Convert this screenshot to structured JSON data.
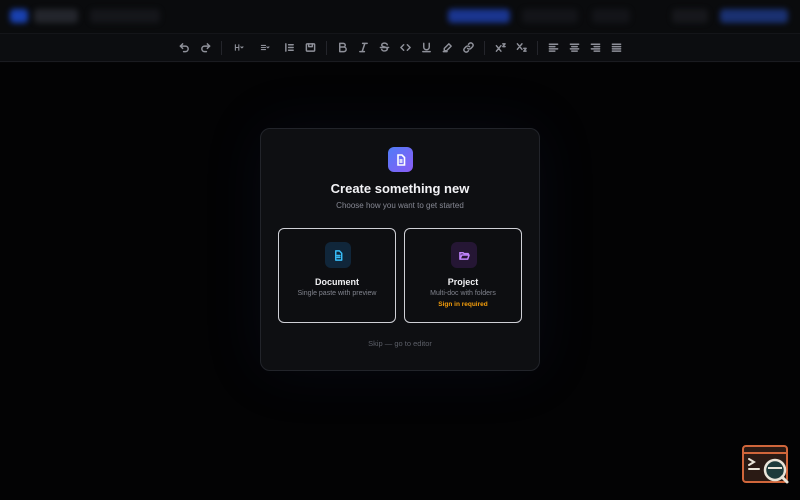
{
  "toolbar": {
    "buttons": [
      {
        "name": "undo-button",
        "icon": "undo-icon"
      },
      {
        "name": "redo-button",
        "icon": "redo-icon"
      },
      {
        "name": "heading-button",
        "icon": "heading-icon"
      },
      {
        "name": "list-button",
        "icon": "list-icon"
      },
      {
        "name": "ordered-list-button",
        "icon": "ordered-list-icon"
      },
      {
        "name": "block-button",
        "icon": "block-icon"
      },
      {
        "name": "bold-button",
        "icon": "bold-icon"
      },
      {
        "name": "italic-button",
        "icon": "italic-icon"
      },
      {
        "name": "strikethrough-button",
        "icon": "strikethrough-icon"
      },
      {
        "name": "code-button",
        "icon": "code-icon"
      },
      {
        "name": "underline-button",
        "icon": "underline-icon"
      },
      {
        "name": "highlight-button",
        "icon": "highlighter-icon"
      },
      {
        "name": "link-button",
        "icon": "link-icon"
      },
      {
        "name": "superscript-button",
        "icon": "superscript-icon"
      },
      {
        "name": "subscript-button",
        "icon": "subscript-icon"
      },
      {
        "name": "align-left-button",
        "icon": "align-left-icon"
      },
      {
        "name": "align-center-button",
        "icon": "align-center-icon"
      },
      {
        "name": "align-right-button",
        "icon": "align-right-icon"
      },
      {
        "name": "align-justify-button",
        "icon": "align-justify-icon"
      }
    ]
  },
  "modal": {
    "icon": "document-icon",
    "title": "Create something new",
    "subtitle": "Choose how you want to get started",
    "cards": [
      {
        "title": "Document",
        "description": "Single paste with preview",
        "icon": "file-text-icon",
        "accent": "#38bdf8"
      },
      {
        "title": "Project",
        "description": "Multi-doc with folders",
        "note": "Sign in required",
        "icon": "folder-open-icon",
        "accent": "#c084fc",
        "note_color": "#f59e0b"
      }
    ],
    "skip_label": "Skip — go to editor"
  },
  "colors": {
    "accent_gradient_start": "#4f7cf7",
    "accent_gradient_end": "#8b5cf6",
    "background": "#050506"
  }
}
